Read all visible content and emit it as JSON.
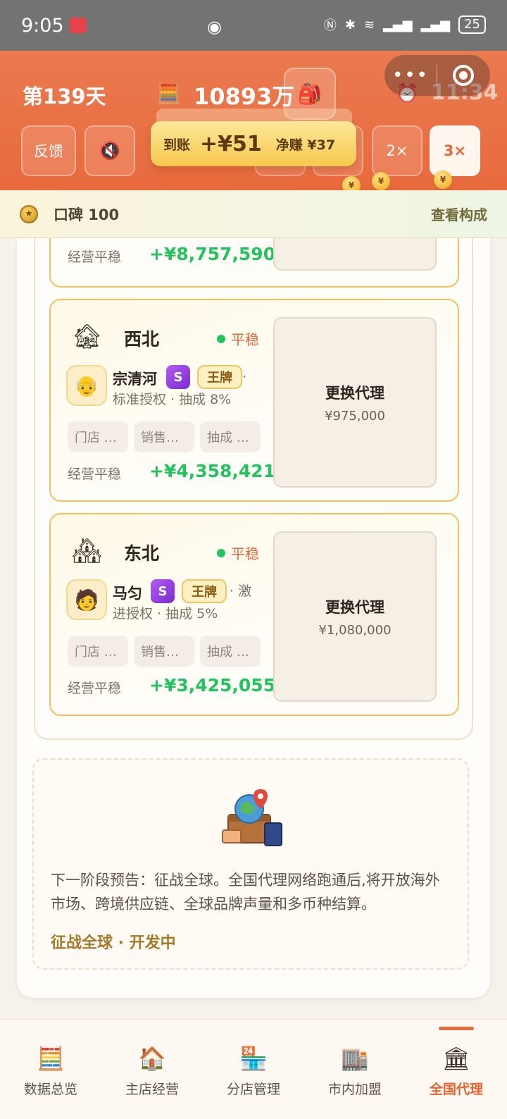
{
  "status_bar": {
    "time": "9:05",
    "battery": "25",
    "icons": [
      "eye-icon",
      "nfc-icon",
      "bluetooth-icon",
      "wifi-icon",
      "signal-4g-icon",
      "signal-4g-icon",
      "battery-icon"
    ]
  },
  "header": {
    "day": "第139天",
    "money": "10893万",
    "clock": "11:34",
    "buttons": {
      "feedback": "反馈",
      "speed2": "2×",
      "speed3": "3×"
    },
    "toast": {
      "received_label": "到账",
      "received_amount": "+¥51",
      "net_label": "净赚 ¥37"
    },
    "coin_symbol": "¥"
  },
  "reputation": {
    "label": "口碑 100",
    "link": "查看构成"
  },
  "partial_card": {
    "op_label": "经营平稳",
    "op_value": "+¥8,757,590"
  },
  "cards": [
    {
      "region": "西北",
      "status": "平稳",
      "agent_name": "宗清河",
      "grade": "S",
      "tag": "王牌",
      "auth_line1": "·",
      "auth_line2": "标准授权 · 抽成 8%",
      "chips": [
        "门店 …",
        "销售…",
        "抽成 …"
      ],
      "op_label": "经营平稳",
      "op_value": "+¥4,358,421",
      "replace_label": "更换代理",
      "replace_price": "¥975,000"
    },
    {
      "region": "东北",
      "status": "平稳",
      "agent_name": "马匀",
      "grade": "S",
      "tag": "王牌",
      "auth_line1": "· 激",
      "auth_line2": "进授权 · 抽成 5%",
      "chips": [
        "门店 …",
        "销售…",
        "抽成 …"
      ],
      "op_label": "经营平稳",
      "op_value": "+¥3,425,055",
      "replace_label": "更换代理",
      "replace_price": "¥1,080,000"
    }
  ],
  "preview": {
    "description": "下一阶段预告：征战全球。全国代理网络跑通后,将开放海外市场、跨境供应链、全球品牌声量和多币种结算。",
    "status": "征战全球 · 开发中"
  },
  "bottom_nav": [
    {
      "label": "数据总览",
      "icon": "cash-register-icon",
      "active": false
    },
    {
      "label": "主店经营",
      "icon": "main-store-icon",
      "active": false
    },
    {
      "label": "分店管理",
      "icon": "branch-store-icon",
      "active": false
    },
    {
      "label": "市内加盟",
      "icon": "city-franchise-icon",
      "active": false
    },
    {
      "label": "全国代理",
      "icon": "national-agency-icon",
      "active": true
    }
  ],
  "colors": {
    "header": "#e86a3d",
    "profit_green": "#22c45e",
    "status_orange": "#e26a3a",
    "card_border": "#f3c160",
    "nav_active": "#e4642f"
  }
}
